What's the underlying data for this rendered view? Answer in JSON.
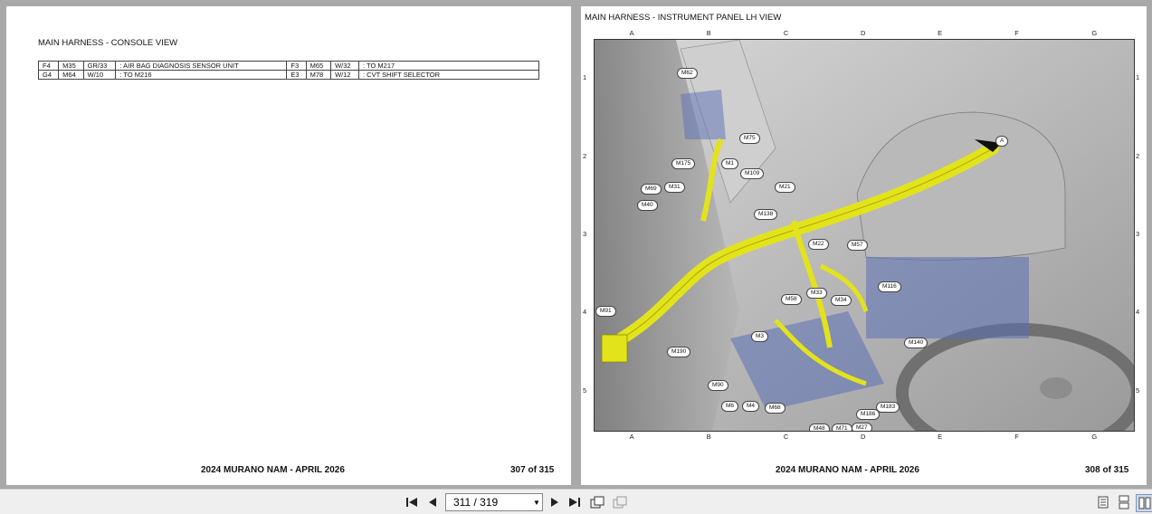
{
  "left_page": {
    "title": "MAIN HARNESS - CONSOLE VIEW",
    "connectors": [
      {
        "grid": "F4",
        "id": "M35",
        "wire": "GR/33",
        "desc": ": AIR BAG DIAGNOSIS SENSOR UNIT",
        "grid2": "F3",
        "id2": "M65",
        "wire2": "W/32",
        "desc2": ": TO M217"
      },
      {
        "grid": "G4",
        "id": "M64",
        "wire": "W/10",
        "desc": ": TO M216",
        "grid2": "E3",
        "id2": "M78",
        "wire2": "W/12",
        "desc2": ": CVT SHIFT SELECTOR"
      }
    ],
    "footer_title": "2024 MURANO NAM - APRIL 2026",
    "footer_page": "307 of 315"
  },
  "right_page": {
    "title": "MAIN HARNESS - INSTRUMENT PANEL LH VIEW",
    "grid_letters": [
      "A",
      "B",
      "C",
      "D",
      "E",
      "F",
      "G"
    ],
    "grid_numbers": [
      "1",
      "2",
      "3",
      "4",
      "5"
    ],
    "callouts": [
      "M62",
      "M75",
      "M175",
      "M1",
      "M109",
      "M69",
      "M31",
      "M21",
      "M40",
      "M138",
      "M22",
      "M57",
      "M116",
      "M33",
      "M58",
      "M34",
      "M91",
      "M3",
      "M140",
      "M190",
      "M90",
      "M6",
      "M4",
      "M68",
      "M186",
      "M183",
      "M48",
      "M71",
      "M27",
      "A"
    ],
    "footer_title": "2024 MURANO NAM - APRIL 2026",
    "footer_page": "308 of 315"
  },
  "toolbar": {
    "page_value": "311 / 319",
    "icons": [
      "first-page-icon",
      "prev-page-icon",
      "next-page-icon",
      "last-page-icon",
      "rotate-icon",
      "copy-icon",
      "single-page-icon",
      "continuous-icon",
      "two-page-icon"
    ]
  }
}
